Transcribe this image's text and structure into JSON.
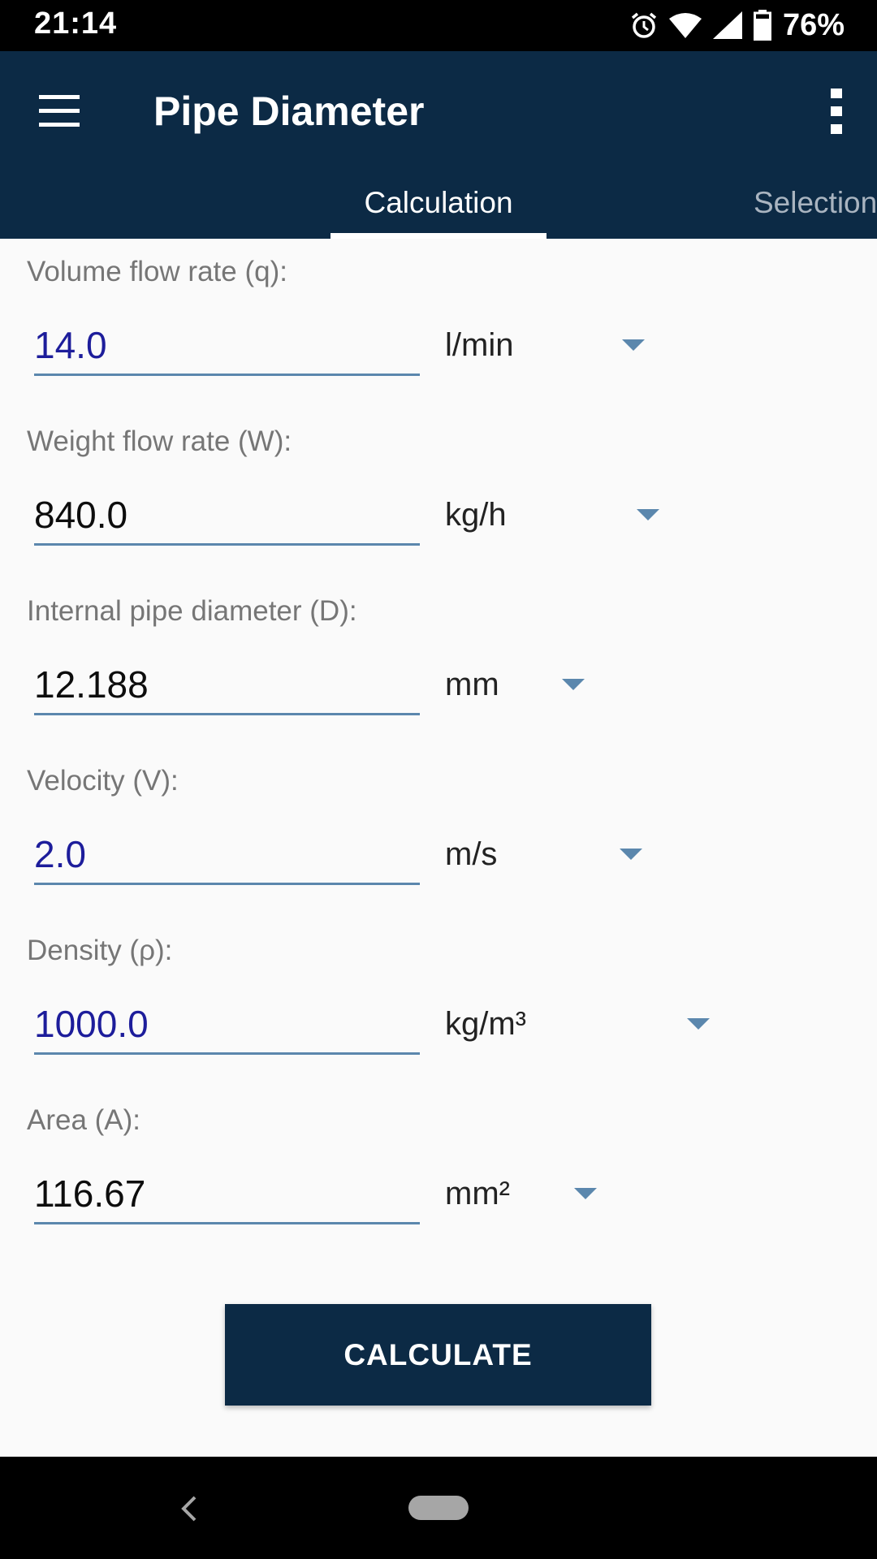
{
  "status_bar": {
    "time": "21:14",
    "battery_percent": "76%",
    "icons": [
      "alarm-icon",
      "wifi-icon",
      "signal-icon",
      "battery-icon"
    ]
  },
  "app_bar": {
    "title": "Pipe Diameter",
    "menu_icon": "hamburger-menu-icon",
    "overflow_icon": "more-vert-icon"
  },
  "tabs": [
    {
      "label": "Calculation",
      "selected": true
    },
    {
      "label": "Selection",
      "selected": false
    }
  ],
  "fields": [
    {
      "label": "Volume flow rate (q):",
      "value": "14.0",
      "unit": "l/min",
      "entered": true
    },
    {
      "label": "Weight flow rate (W):",
      "value": "840.0",
      "unit": "kg/h",
      "entered": false
    },
    {
      "label": "Internal pipe diameter (D):",
      "value": "12.188",
      "unit": "mm",
      "entered": false
    },
    {
      "label": "Velocity (V):",
      "value": "2.0",
      "unit": "m/s",
      "entered": true
    },
    {
      "label": "Density (ρ):",
      "value": "1000.0",
      "unit": "kg/m³",
      "entered": true
    },
    {
      "label": "Area (A):",
      "value": "116.67",
      "unit": "mm²",
      "entered": false
    }
  ],
  "calculate_button": {
    "label": "CALCULATE"
  },
  "colors": {
    "primary": "#0c2a45",
    "accent": "#5b87ad",
    "entered_text": "#1d1d9b",
    "computed_text": "#0d0d0d"
  }
}
